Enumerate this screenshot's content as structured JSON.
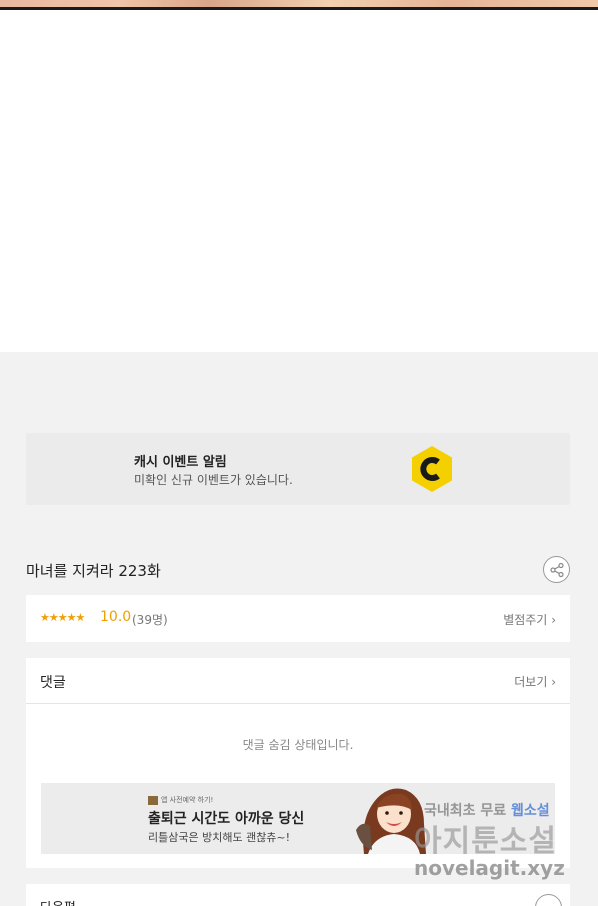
{
  "cash_banner": {
    "title": "캐시 이벤트 알림",
    "description": "미확인 신규 이벤트가 있습니다.",
    "coin_letter": "C",
    "coin_color": "#f5d000"
  },
  "episode": {
    "title": "마녀를 지켜라 223화"
  },
  "rating": {
    "stars": "★★★★★",
    "score": "10.0",
    "count": "(39명)",
    "rate_link": "별점주기",
    "star_color": "#f0a000"
  },
  "comments": {
    "title": "댓글",
    "more": "더보기",
    "hidden_message": "댓글 숨김 상태입니다."
  },
  "ad": {
    "sponsor": "앱 사전예약 하기!",
    "headline": "출퇴근 시간도 아까운 당신",
    "subtext": "리틀삼국은 방치해도 괜찮츄~!"
  },
  "next": {
    "title": "다음편"
  },
  "watermark": {
    "line1_prefix": "국내최초 무료",
    "line1_highlight": "웹소설",
    "line2": "아지툰소설",
    "line3": "novelagit.xyz"
  }
}
